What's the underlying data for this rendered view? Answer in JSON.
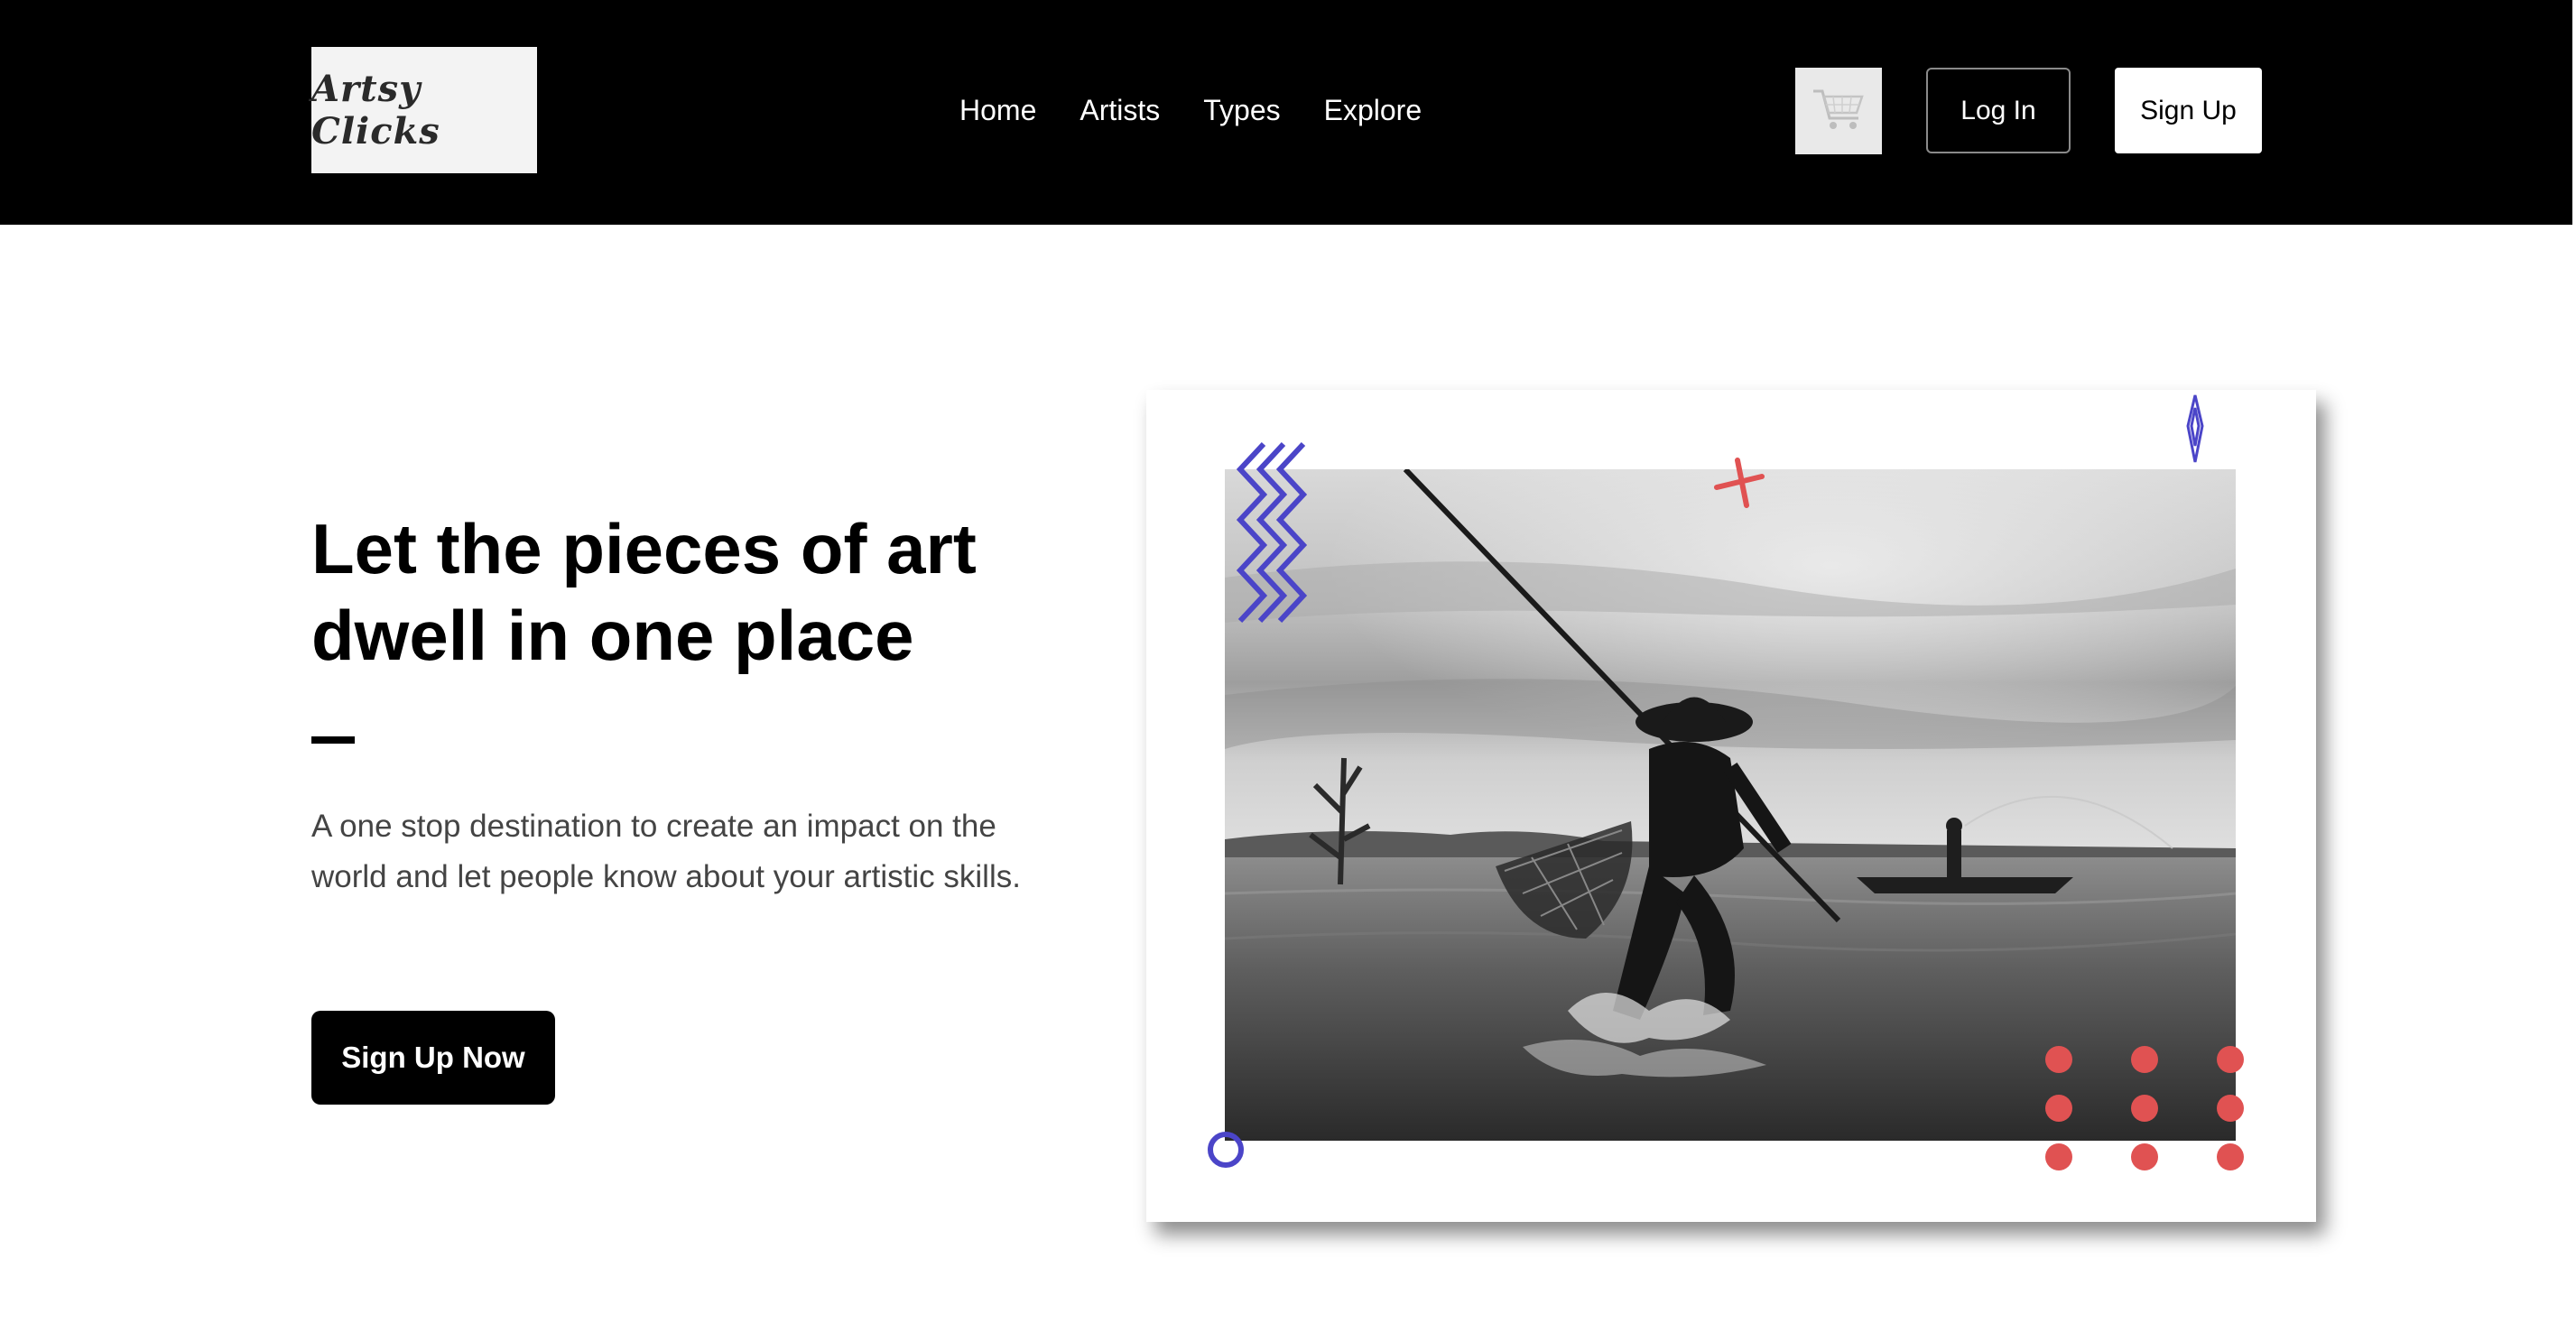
{
  "header": {
    "logo_text": "Artsy Clicks",
    "nav": [
      {
        "label": "Home"
      },
      {
        "label": "Artists"
      },
      {
        "label": "Types"
      },
      {
        "label": "Explore"
      }
    ],
    "cart_icon": "shopping-cart-icon",
    "login_label": "Log In",
    "signup_label": "Sign Up"
  },
  "hero": {
    "title": "Let the pieces of art dwell in one place",
    "description": "A one stop destination to create an impact on the world and let people know about your artistic skills.",
    "cta_label": "Sign Up Now"
  },
  "colors": {
    "header_bg": "#000000",
    "accent_blue": "#4b45c8",
    "accent_red": "#e05252"
  }
}
